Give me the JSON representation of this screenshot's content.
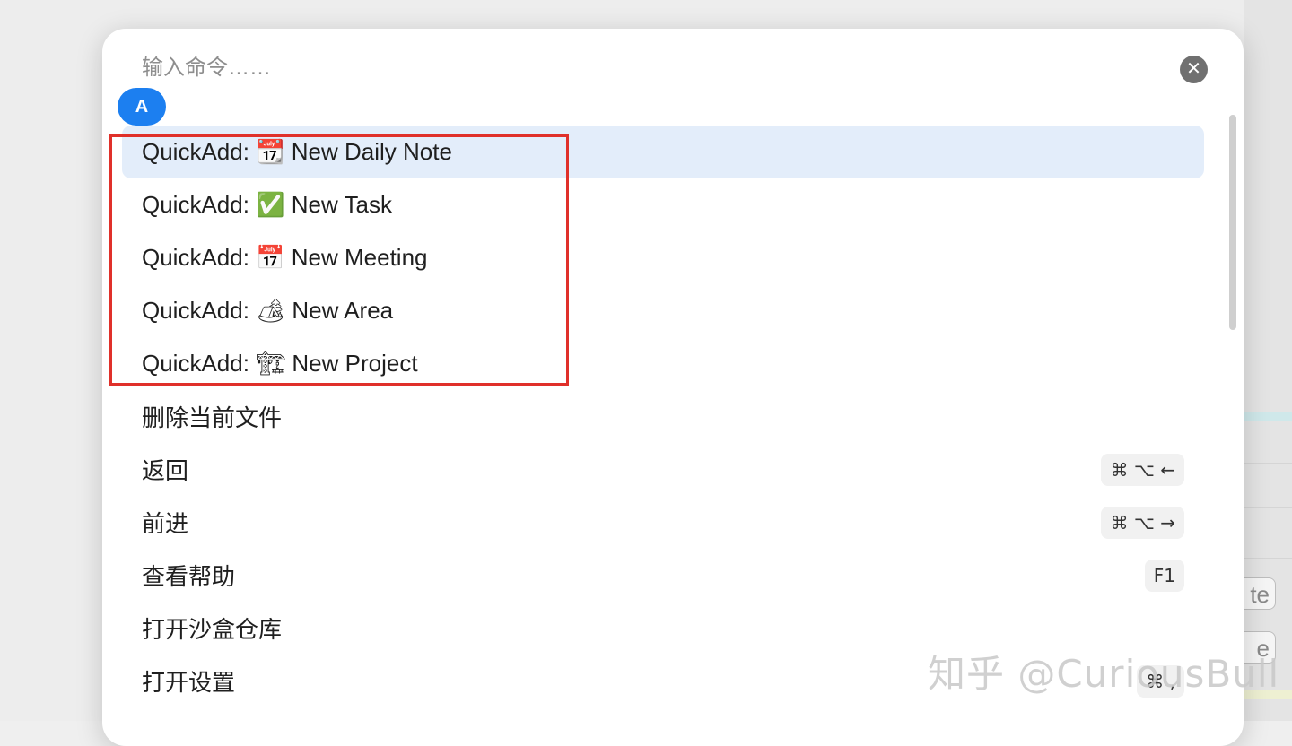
{
  "search": {
    "placeholder": "输入命令……",
    "value": ""
  },
  "avatar_letter": "A",
  "clear_icon": "✕",
  "items": [
    {
      "label": "QuickAdd: 📆 New Daily Note",
      "hotkey": ""
    },
    {
      "label": "QuickAdd: ✅ New Task",
      "hotkey": ""
    },
    {
      "label": "QuickAdd: 📅 New Meeting",
      "hotkey": ""
    },
    {
      "label": "QuickAdd: 🏕 New Area",
      "hotkey": ""
    },
    {
      "label": "QuickAdd: 🏗 New Project",
      "hotkey": ""
    },
    {
      "label": "删除当前文件",
      "hotkey": ""
    },
    {
      "label": "返回",
      "hotkey": "⌘ ⌥ ←"
    },
    {
      "label": "前进",
      "hotkey": "⌘ ⌥ →"
    },
    {
      "label": "查看帮助",
      "hotkey": "F1"
    },
    {
      "label": "打开沙盒仓库",
      "hotkey": ""
    },
    {
      "label": "打开设置",
      "hotkey": "⌘ ,"
    }
  ],
  "background_buttons": [
    "te",
    "e"
  ],
  "watermark": "知乎 @CuriousBull",
  "colors": {
    "selection": "#e3edfa",
    "annotation_box": "#e0302a",
    "avatar": "#1c7ff0"
  }
}
